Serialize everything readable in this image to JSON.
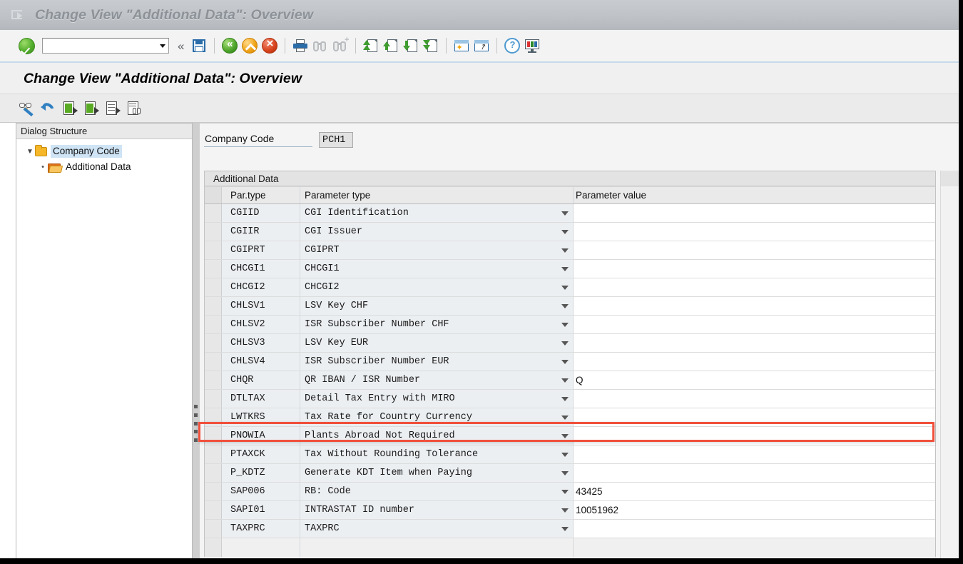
{
  "window": {
    "title": "Change View \"Additional Data\": Overview",
    "icon": "window-menu-icon"
  },
  "system_toolbar": {
    "ok_button": "ok-check-icon",
    "command_field": {
      "value": "",
      "placeholder": ""
    },
    "buttons": [
      {
        "name": "save-icon",
        "label": "Save"
      },
      {
        "name": "back-icon",
        "label": "Back"
      },
      {
        "name": "exit-icon",
        "label": "Exit"
      },
      {
        "name": "cancel-icon",
        "label": "Cancel"
      },
      {
        "name": "print-icon",
        "label": "Print"
      },
      {
        "name": "find-icon",
        "label": "Find"
      },
      {
        "name": "find-next-icon",
        "label": "Find Next"
      },
      {
        "name": "first-page-icon",
        "label": "First Page"
      },
      {
        "name": "previous-page-icon",
        "label": "Previous Page"
      },
      {
        "name": "next-page-icon",
        "label": "Next Page"
      },
      {
        "name": "last-page-icon",
        "label": "Last Page"
      },
      {
        "name": "create-variant-icon",
        "label": "Create Session"
      },
      {
        "name": "create-shortcut-icon",
        "label": "Create Shortcut"
      },
      {
        "name": "help-icon",
        "label": "Help"
      },
      {
        "name": "layout-menu-icon",
        "label": "Customize Local Layout"
      }
    ]
  },
  "screen": {
    "title": "Change View \"Additional Data\": Overview"
  },
  "app_toolbar": {
    "buttons": [
      {
        "name": "display-change-icon",
        "label": "Display/Change"
      },
      {
        "name": "undo-icon",
        "label": "Undo Change"
      },
      {
        "name": "new-entries-icon",
        "label": "New Entries"
      },
      {
        "name": "copy-as-icon",
        "label": "Copy As"
      },
      {
        "name": "delete-icon",
        "label": "Delete"
      },
      {
        "name": "select-all-icon",
        "label": "Select All"
      }
    ]
  },
  "dialog_structure": {
    "header": "Dialog Structure",
    "items": [
      {
        "label": "Company Code",
        "icon": "folder-closed-icon",
        "selected": true,
        "level": 0,
        "expanded": true
      },
      {
        "label": "Additional Data",
        "icon": "folder-open-icon",
        "selected": false,
        "level": 1
      }
    ]
  },
  "form": {
    "company_code_label": "Company Code",
    "company_code_value": "PCH1"
  },
  "table": {
    "group_title": "Additional Data",
    "columns": [
      "Par.type",
      "Parameter type",
      "Parameter value"
    ],
    "highlight_row_index": 9,
    "highlight_color": "#f1503c",
    "rows": [
      {
        "par_type": "CGIID",
        "parameter_type": "CGI Identification",
        "parameter_value": ""
      },
      {
        "par_type": "CGIIR",
        "parameter_type": "CGI Issuer",
        "parameter_value": ""
      },
      {
        "par_type": "CGIPRT",
        "parameter_type": "CGIPRT",
        "parameter_value": ""
      },
      {
        "par_type": "CHCGI1",
        "parameter_type": "CHCGI1",
        "parameter_value": ""
      },
      {
        "par_type": "CHCGI2",
        "parameter_type": "CHCGI2",
        "parameter_value": ""
      },
      {
        "par_type": "CHLSV1",
        "parameter_type": "LSV Key CHF",
        "parameter_value": ""
      },
      {
        "par_type": "CHLSV2",
        "parameter_type": "ISR Subscriber Number CHF",
        "parameter_value": ""
      },
      {
        "par_type": "CHLSV3",
        "parameter_type": "LSV Key EUR",
        "parameter_value": ""
      },
      {
        "par_type": "CHLSV4",
        "parameter_type": "ISR Subscriber Number EUR",
        "parameter_value": ""
      },
      {
        "par_type": "CHQR",
        "parameter_type": "QR IBAN / ISR Number",
        "parameter_value": "Q"
      },
      {
        "par_type": "DTLTAX",
        "parameter_type": "Detail Tax Entry with MIRO",
        "parameter_value": ""
      },
      {
        "par_type": "LWTKRS",
        "parameter_type": "Tax Rate for Country Currency",
        "parameter_value": ""
      },
      {
        "par_type": "PNOWIA",
        "parameter_type": "Plants Abroad Not Required",
        "parameter_value": ""
      },
      {
        "par_type": "PTAXCK",
        "parameter_type": "Tax Without Rounding Tolerance",
        "parameter_value": ""
      },
      {
        "par_type": "P_KDTZ",
        "parameter_type": "Generate KDT Item when Paying",
        "parameter_value": ""
      },
      {
        "par_type": "SAP006",
        "parameter_type": "RB: Code",
        "parameter_value": "43425"
      },
      {
        "par_type": "SAPI01",
        "parameter_type": "INTRASTAT ID number",
        "parameter_value": "10051962"
      },
      {
        "par_type": "TAXPRC",
        "parameter_type": "TAXPRC",
        "parameter_value": ""
      },
      {
        "par_type": "",
        "parameter_type": "",
        "parameter_value": ""
      }
    ]
  }
}
